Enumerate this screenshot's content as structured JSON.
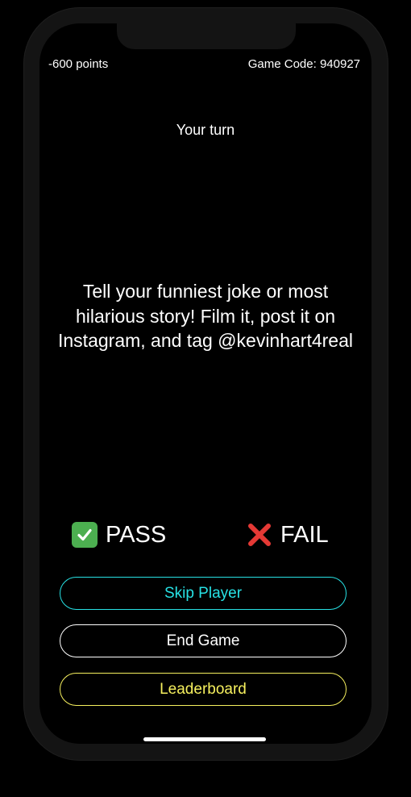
{
  "status": {
    "points": "-600 points",
    "game_code": "Game Code: 940927"
  },
  "turn_label": "Your turn",
  "prompt": "Tell your funniest joke or most hilarious story! Film it, post it on Instagram, and tag @kevinhart4real",
  "verdicts": {
    "pass": {
      "icon": "check-mark-icon",
      "label": "PASS"
    },
    "fail": {
      "icon": "cross-mark-icon",
      "label": "FAIL"
    }
  },
  "buttons": {
    "skip": "Skip Player",
    "end": "End Game",
    "leaderboard": "Leaderboard"
  },
  "colors": {
    "background": "#000000",
    "skip_accent": "#27e1e4",
    "leaderboard_accent": "#f6f05e",
    "pass_green": "#4caf50",
    "fail_red": "#e53935"
  }
}
